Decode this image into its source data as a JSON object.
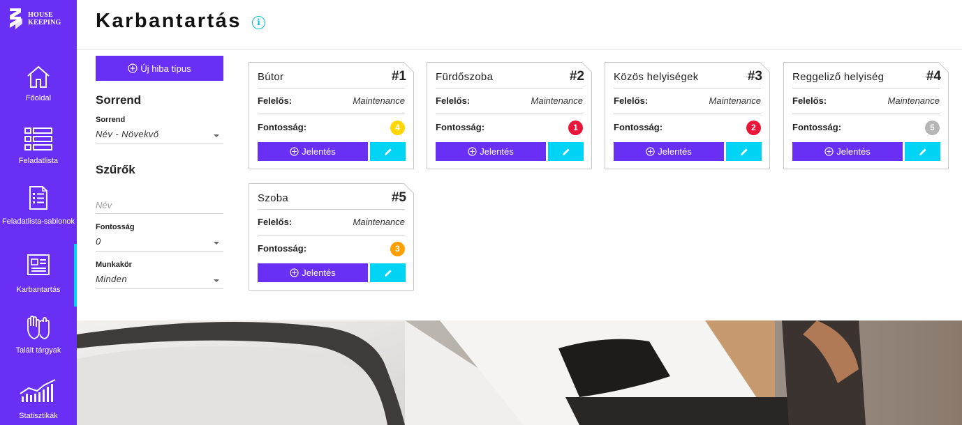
{
  "app": {
    "logo_line1": "HOUSE",
    "logo_line2": "KEEPING"
  },
  "sidebar": {
    "items": [
      {
        "label": "Főoldal",
        "icon": "home-icon"
      },
      {
        "label": "Feladatlista",
        "icon": "list-icon"
      },
      {
        "label": "Feladatlista-sablonok",
        "icon": "checklist-template-icon"
      },
      {
        "label": "Karbantartás",
        "icon": "maintenance-document-icon",
        "active": true
      },
      {
        "label": "Talált tárgyak",
        "icon": "gloves-icon"
      },
      {
        "label": "Statisztikák",
        "icon": "chart-icon"
      }
    ]
  },
  "header": {
    "title": "Karbantartás",
    "info_icon": "i"
  },
  "panel": {
    "new_button": "Új hiba típus",
    "sort_heading": "Sorrend",
    "sort_label": "Sorrend",
    "sort_value": "Név - Növekvő",
    "filters_heading": "Szűrők",
    "name_placeholder": "Név",
    "priority_label": "Fontosság",
    "priority_value": "0",
    "role_label": "Munkakör",
    "role_value": "Minden"
  },
  "cards": [
    {
      "title": "Bútor",
      "number": "#1",
      "responsible_label": "Felelős:",
      "responsible": "Maintenance",
      "priority_label": "Fontosság:",
      "priority": "4",
      "priority_color": "#ffd600",
      "report": "Jelentés"
    },
    {
      "title": "Fürdőszoba",
      "number": "#2",
      "responsible_label": "Felelős:",
      "responsible": "Maintenance",
      "priority_label": "Fontosság:",
      "priority": "1",
      "priority_color": "#e8173a",
      "report": "Jelentés"
    },
    {
      "title": "Közös helyiségek",
      "number": "#3",
      "responsible_label": "Felelős:",
      "responsible": "Maintenance",
      "priority_label": "Fontosság:",
      "priority": "2",
      "priority_color": "#e8173a",
      "report": "Jelentés"
    },
    {
      "title": "Reggeliző helyiség",
      "number": "#4",
      "responsible_label": "Felelős:",
      "responsible": "Maintenance",
      "priority_label": "Fontosság:",
      "priority": "5",
      "priority_color": "#b5b5b5",
      "report": "Jelentés"
    },
    {
      "title": "Szoba",
      "number": "#5",
      "responsible_label": "Felelős:",
      "responsible": "Maintenance",
      "priority_label": "Fontosság:",
      "priority": "3",
      "priority_color": "#ffa000",
      "report": "Jelentés"
    }
  ],
  "colors": {
    "accent": "#6a2ff5",
    "cyan": "#00d4f5"
  }
}
